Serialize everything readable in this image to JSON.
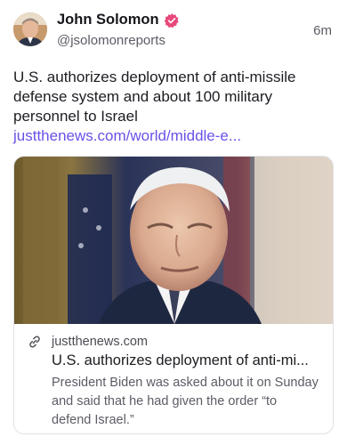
{
  "author": {
    "name": "John Solomon",
    "handle": "@jsolomonreports",
    "verified_color": "#e8487a"
  },
  "post": {
    "time": "6m",
    "text": "U.S. authorizes deployment of anti-missile defense system and about 100 military personnel to Israel ",
    "link_text": "justthenews.com/world/middle-e...",
    "link_color": "#6b50e8"
  },
  "link_card": {
    "domain": "justthenews.com",
    "title": "U.S. authorizes deployment of anti-mi...",
    "description": "President Biden was asked about it on Sunday and said that he had given the order “to defend Israel.”"
  },
  "icons": {
    "verified": "verified-badge-icon",
    "link": "link-icon"
  }
}
